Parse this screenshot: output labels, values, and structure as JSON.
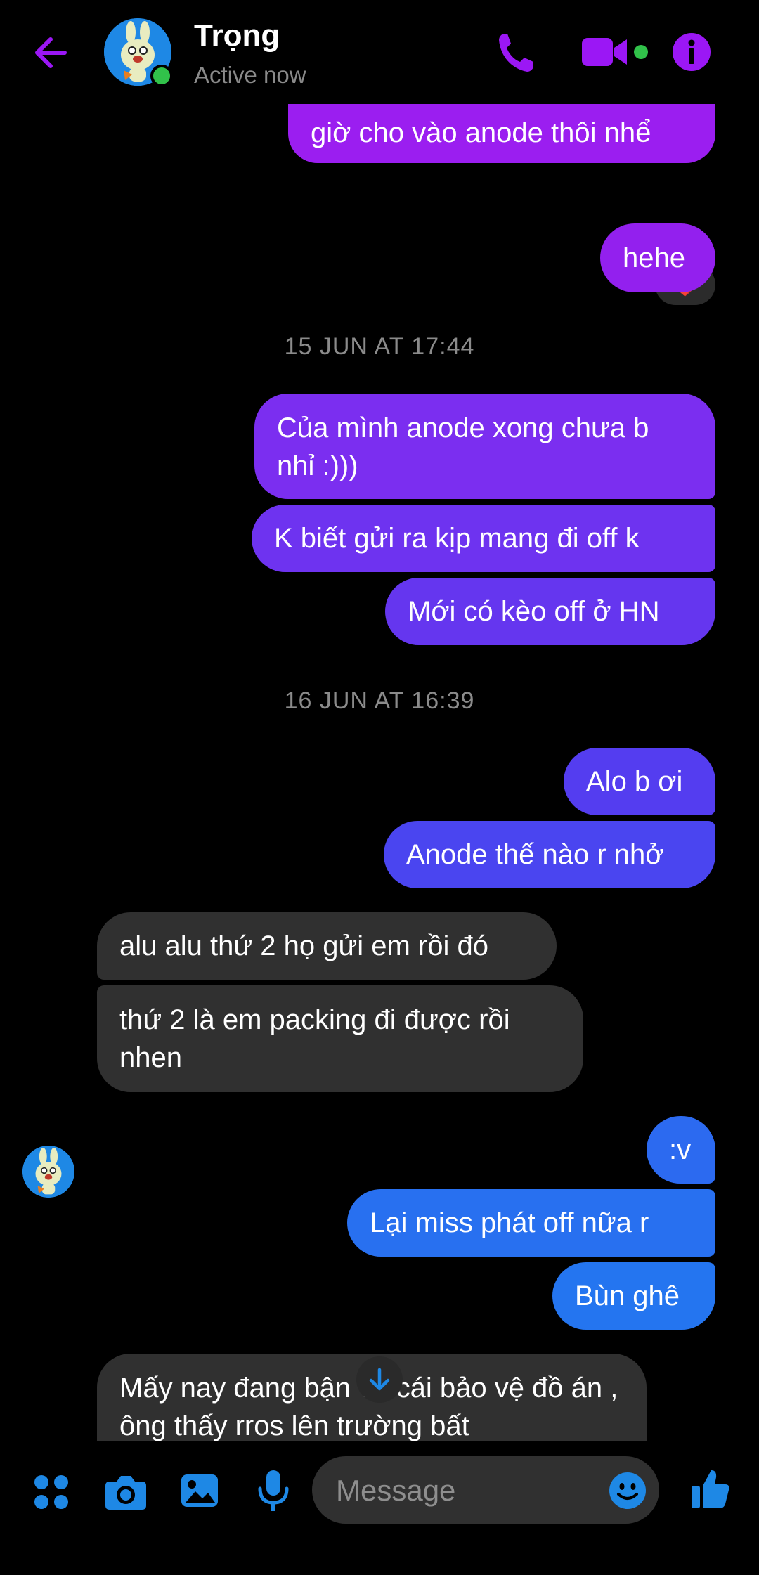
{
  "header": {
    "name": "Trọng",
    "status": "Active now"
  },
  "messages": {
    "m1": "giờ cho vào anode thôi nhể",
    "m1_reaction": "❤️",
    "m2": "hehe",
    "ts1": "15 JUN AT 17:44",
    "m3": "Của mình anode xong chưa b nhỉ :)))",
    "m4": "K biết gửi ra kịp mang đi off k",
    "m5": "Mới có kèo off ở HN",
    "ts2": "16 JUN AT 16:39",
    "m6": "Alo b ơi",
    "m7": "Anode thế nào r nhở",
    "t1": "alu alu thứ 2 họ gửi em rồi đó",
    "t2": "thứ 2 là em packing đi được rồi nhen",
    "m8": ":v",
    "m9": "Lại miss phát off nữa r",
    "m10": "Bùn ghê",
    "t3": "Mấy nay đang bận vụ cái bảo vệ đồ án , ông thấy rros lên trường bất"
  },
  "composer": {
    "placeholder": "Message"
  },
  "colors": {
    "accent_purple": "#9b17f5",
    "bubble_gradient_top": "#8a2be2",
    "bubble_gradient_bottom": "#1f7cf0",
    "icon_blue": "#1e88e5",
    "online_green": "#31c24a"
  }
}
